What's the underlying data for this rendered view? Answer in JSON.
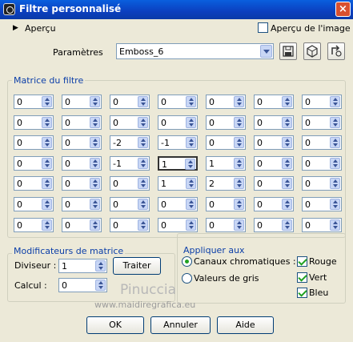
{
  "window": {
    "title": "Filtre personnalisé"
  },
  "preview": {
    "toggle_label": "Aperçu",
    "image_preview_label": "Aperçu de l'image",
    "image_preview_checked": false
  },
  "params": {
    "label": "Paramètres",
    "value": "Emboss_6"
  },
  "matrix": {
    "legend": "Matrice du filtre",
    "rows": [
      [
        "0",
        "0",
        "0",
        "0",
        "0",
        "0",
        "0"
      ],
      [
        "0",
        "0",
        "0",
        "0",
        "0",
        "0",
        "0"
      ],
      [
        "0",
        "0",
        "-2",
        "-1",
        "0",
        "0",
        "0"
      ],
      [
        "0",
        "0",
        "-1",
        "1",
        "1",
        "0",
        "0"
      ],
      [
        "0",
        "0",
        "0",
        "1",
        "2",
        "0",
        "0"
      ],
      [
        "0",
        "0",
        "0",
        "0",
        "0",
        "0",
        "0"
      ],
      [
        "0",
        "0",
        "0",
        "0",
        "0",
        "0",
        "0"
      ]
    ]
  },
  "modifiers": {
    "legend": "Modificateurs de matrice",
    "divisor_label": "Diviseur :",
    "divisor_value": "1",
    "bias_label": "Calcul :",
    "bias_value": "0",
    "process_label": "Traiter"
  },
  "apply": {
    "legend": "Appliquer aux",
    "chromatic_label": "Canaux chromatiques :",
    "gray_label": "Valeurs de gris",
    "selected": "chromatic",
    "red_label": "Rouge",
    "green_label": "Vert",
    "blue_label": "Bleu",
    "red_checked": true,
    "green_checked": true,
    "blue_checked": true
  },
  "watermark": {
    "name": "Pinuccia",
    "url": "www.maidiregrafica.eu"
  },
  "buttons": {
    "ok": "OK",
    "cancel": "Annuler",
    "help": "Aide"
  },
  "colors": {
    "titlebar": "#0a4fd0",
    "dialog_bg": "#ece9d8",
    "group_title": "#0b3ea8",
    "check_mark": "#21a121"
  },
  "icons": [
    "camera-icon",
    "close-icon",
    "save-icon",
    "cube-icon",
    "reset-icon",
    "chevron-right-icon"
  ]
}
